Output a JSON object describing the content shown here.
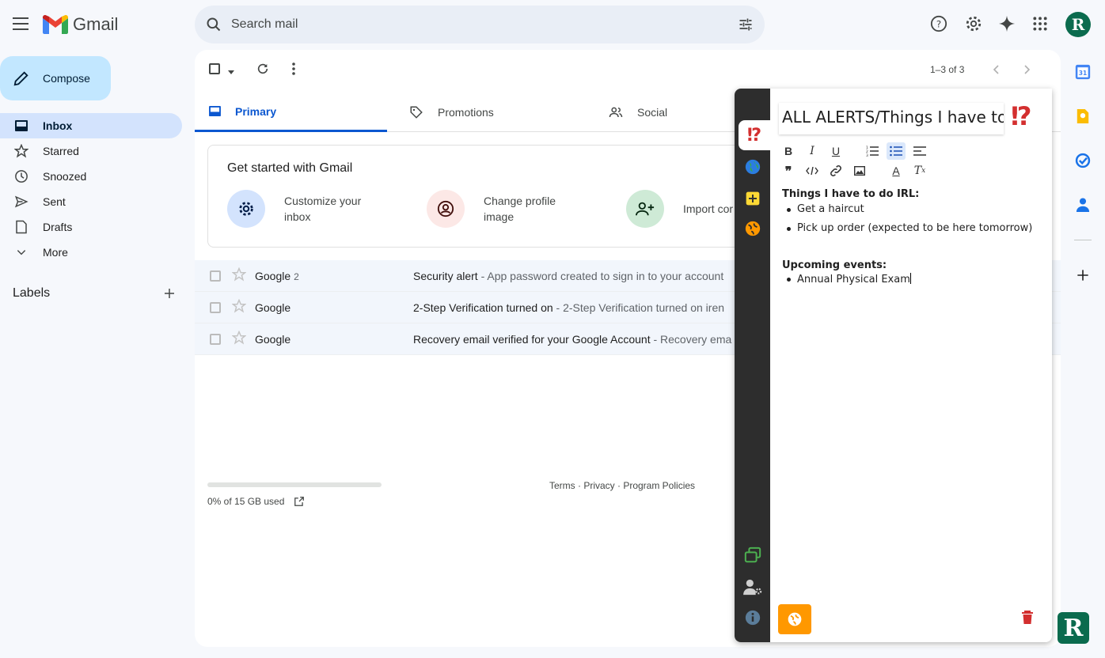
{
  "header": {
    "logo_text": "Gmail",
    "search_placeholder": "Search mail",
    "avatar_letter": "R"
  },
  "sidebar": {
    "compose_label": "Compose",
    "items": [
      {
        "label": "Inbox",
        "icon": "inbox-icon",
        "active": true
      },
      {
        "label": "Starred",
        "icon": "star-icon"
      },
      {
        "label": "Snoozed",
        "icon": "clock-icon"
      },
      {
        "label": "Sent",
        "icon": "send-icon"
      },
      {
        "label": "Drafts",
        "icon": "draft-icon"
      },
      {
        "label": "More",
        "icon": "chevron-down-icon"
      }
    ],
    "labels_heading": "Labels"
  },
  "toolbar": {
    "pager": "1–3 of 3"
  },
  "tabs": [
    {
      "label": "Primary",
      "icon": "inbox-icon",
      "active": true
    },
    {
      "label": "Promotions",
      "icon": "tag-icon"
    },
    {
      "label": "Social",
      "icon": "people-icon"
    }
  ],
  "get_started": {
    "title": "Get started with Gmail",
    "items": [
      {
        "label": "Customize your inbox",
        "icon": "gear-icon",
        "color": "#d3e3fd"
      },
      {
        "label": "Change profile image",
        "icon": "profile-icon",
        "color": "#fce8e6"
      },
      {
        "label": "Import cor and mail",
        "icon": "add-person-icon",
        "color": "#ceead6"
      }
    ]
  },
  "emails": [
    {
      "sender": "Google",
      "count": "2",
      "subject": "Security alert",
      "snippet": " - App password created to sign in to your account"
    },
    {
      "sender": "Google",
      "count": "",
      "subject": "2-Step Verification turned on",
      "snippet": " - 2-Step Verification turned on iren"
    },
    {
      "sender": "Google",
      "count": "",
      "subject": "Recovery email verified for your Google Account",
      "snippet": " - Recovery ema"
    }
  ],
  "storage": {
    "used_text": "0% of 15 GB used",
    "used_fraction": 0.0
  },
  "footer": {
    "links": "Terms · Privacy · Program Policies"
  },
  "notes": {
    "title": "ALL ALERTS/Things I have to",
    "emoji": "⁉",
    "sections": [
      {
        "heading": "Things I have to do IRL:",
        "items": [
          "Get a haircut",
          "Pick up order (expected to be here tomorrow)"
        ]
      },
      {
        "heading": "Upcoming events:",
        "items": [
          "Annual Physical Exam"
        ]
      }
    ]
  },
  "badge_letter": "R",
  "colors": {
    "accent_blue": "#0b57d0",
    "compose_bg": "#c2e7ff",
    "active_nav": "#d3e3fd",
    "notes_orange": "#ff9800",
    "brand_green": "#0b6b4e"
  }
}
